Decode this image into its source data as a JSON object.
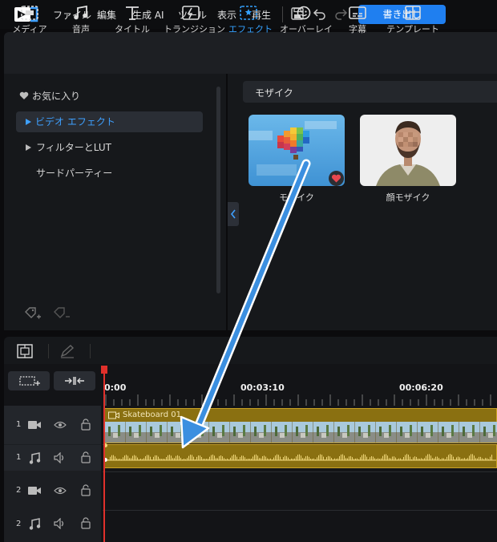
{
  "menubar": {
    "items": [
      "ファイル",
      "編集",
      "生成 AI",
      "ツール",
      "表示",
      "再生"
    ],
    "export_label": "書き出し"
  },
  "tools": [
    {
      "label": "メディア",
      "icon": "media-icon"
    },
    {
      "label": "音声",
      "icon": "music-note-icon"
    },
    {
      "label": "タイトル",
      "icon": "title-t-icon"
    },
    {
      "label": "トランジション",
      "icon": "transition-icon"
    },
    {
      "label": "エフェクト",
      "icon": "effect-icon",
      "active": true
    },
    {
      "label": "オーバーレイ",
      "icon": "overlay-icon"
    },
    {
      "label": "字幕",
      "icon": "subtitle-icon"
    },
    {
      "label": "テンプレート",
      "icon": "template-icon"
    }
  ],
  "sidebar": {
    "items": [
      {
        "label": "お気に入り",
        "icon": "heart-icon"
      },
      {
        "label": "ビデオ エフェクト",
        "icon": "caret-right-icon",
        "selected": true
      },
      {
        "label": "フィルターとLUT",
        "icon": "caret-right-icon"
      },
      {
        "label": "サードパーティー"
      }
    ]
  },
  "effects": {
    "category": "モザイク",
    "items": [
      {
        "label": "モザイク",
        "favorite": true
      },
      {
        "label": "顔モザイク"
      }
    ]
  },
  "timeline": {
    "ruler_labels": [
      "0:00",
      "00:03:10",
      "00:06:20"
    ],
    "clip_name": "Skateboard 01",
    "tracks": [
      {
        "num": "1",
        "type": "video"
      },
      {
        "num": "1",
        "type": "audio"
      },
      {
        "num": "2",
        "type": "video"
      },
      {
        "num": "2",
        "type": "audio"
      }
    ]
  },
  "colors": {
    "accent": "#1f7ff0",
    "active_tab": "#35a2ff",
    "clip": "#8a7011",
    "playhead": "#e0302b",
    "favorite": "#e8474f"
  }
}
